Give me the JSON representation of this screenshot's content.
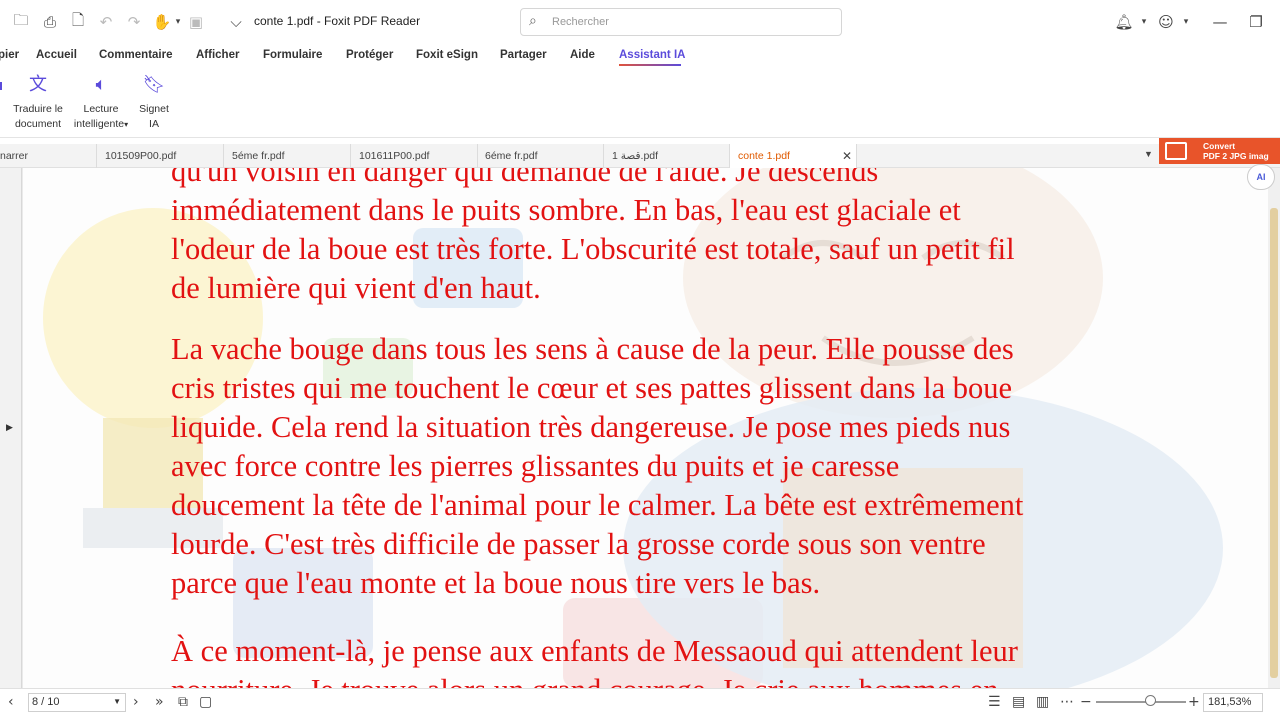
{
  "window": {
    "title": "conte 1.pdf - Foxit PDF Reader",
    "search_placeholder": "Rechercher"
  },
  "icons": {
    "open": "folder-icon",
    "print": "printer-icon",
    "new": "new-document-icon",
    "undo": "undo-icon",
    "redo": "redo-icon",
    "hand": "hand-tool-icon",
    "save": "save-icon",
    "quick_access": "chevron-down-icon",
    "bell": "bell-icon",
    "account": "user-icon",
    "minimize": "minimize-icon",
    "restore": "restore-icon"
  },
  "menu": {
    "items": [
      "pier",
      "Accueil",
      "Commentaire",
      "Afficher",
      "Formulaire",
      "Protéger",
      "Foxit eSign",
      "Partager",
      "Aide",
      "Assistant IA"
    ],
    "active": "Assistant IA"
  },
  "ribbon": {
    "translate_l1": "Traduire le",
    "translate_l2": "document",
    "reading_l1": "Lecture",
    "reading_l2": "intelligente",
    "bookmark_l1": "Signet",
    "bookmark_l2": "IA"
  },
  "tabs": [
    "narrer",
    "101509P00.pdf",
    "5éme fr.pdf",
    "101611P00.pdf",
    "6éme fr.pdf",
    "1 قصة.pdf",
    "conte 1.pdf"
  ],
  "active_tab": "conte 1.pdf",
  "ad": {
    "line1": "Convert",
    "line2": "PDF 2 JPG imag"
  },
  "ai_badge": "AI",
  "document": {
    "p0": [
      "qu'un voisin en danger qui demande de l'aide. Je descends",
      "immédiatement dans le puits sombre. En bas, l'eau est glaciale et",
      "l'odeur de la boue est très forte. L'obscurité est totale, sauf un petit fil",
      "de lumière qui vient d'en haut."
    ],
    "p1": [
      "La vache bouge dans tous les sens à cause de la peur. Elle pousse des",
      "cris tristes qui me touchent le cœur et ses pattes glissent dans la boue",
      "liquide. Cela rend la situation très dangereuse. Je pose mes pieds nus",
      "avec force contre les pierres glissantes du puits et je caresse",
      "doucement la tête de l'animal pour le calmer. La bête est extrêmement",
      "lourde. C'est très difficile de passer la grosse corde sous son ventre",
      "parce que l'eau monte et la boue nous tire vers le bas."
    ],
    "p2": [
      "À ce moment-là, je pense aux enfants de Messaoud qui attendent leur",
      "nourriture. Je trouve alors un grand courage. Je crie aux hommes en"
    ]
  },
  "status": {
    "page": "8 / 10",
    "zoom": "181,53%"
  }
}
